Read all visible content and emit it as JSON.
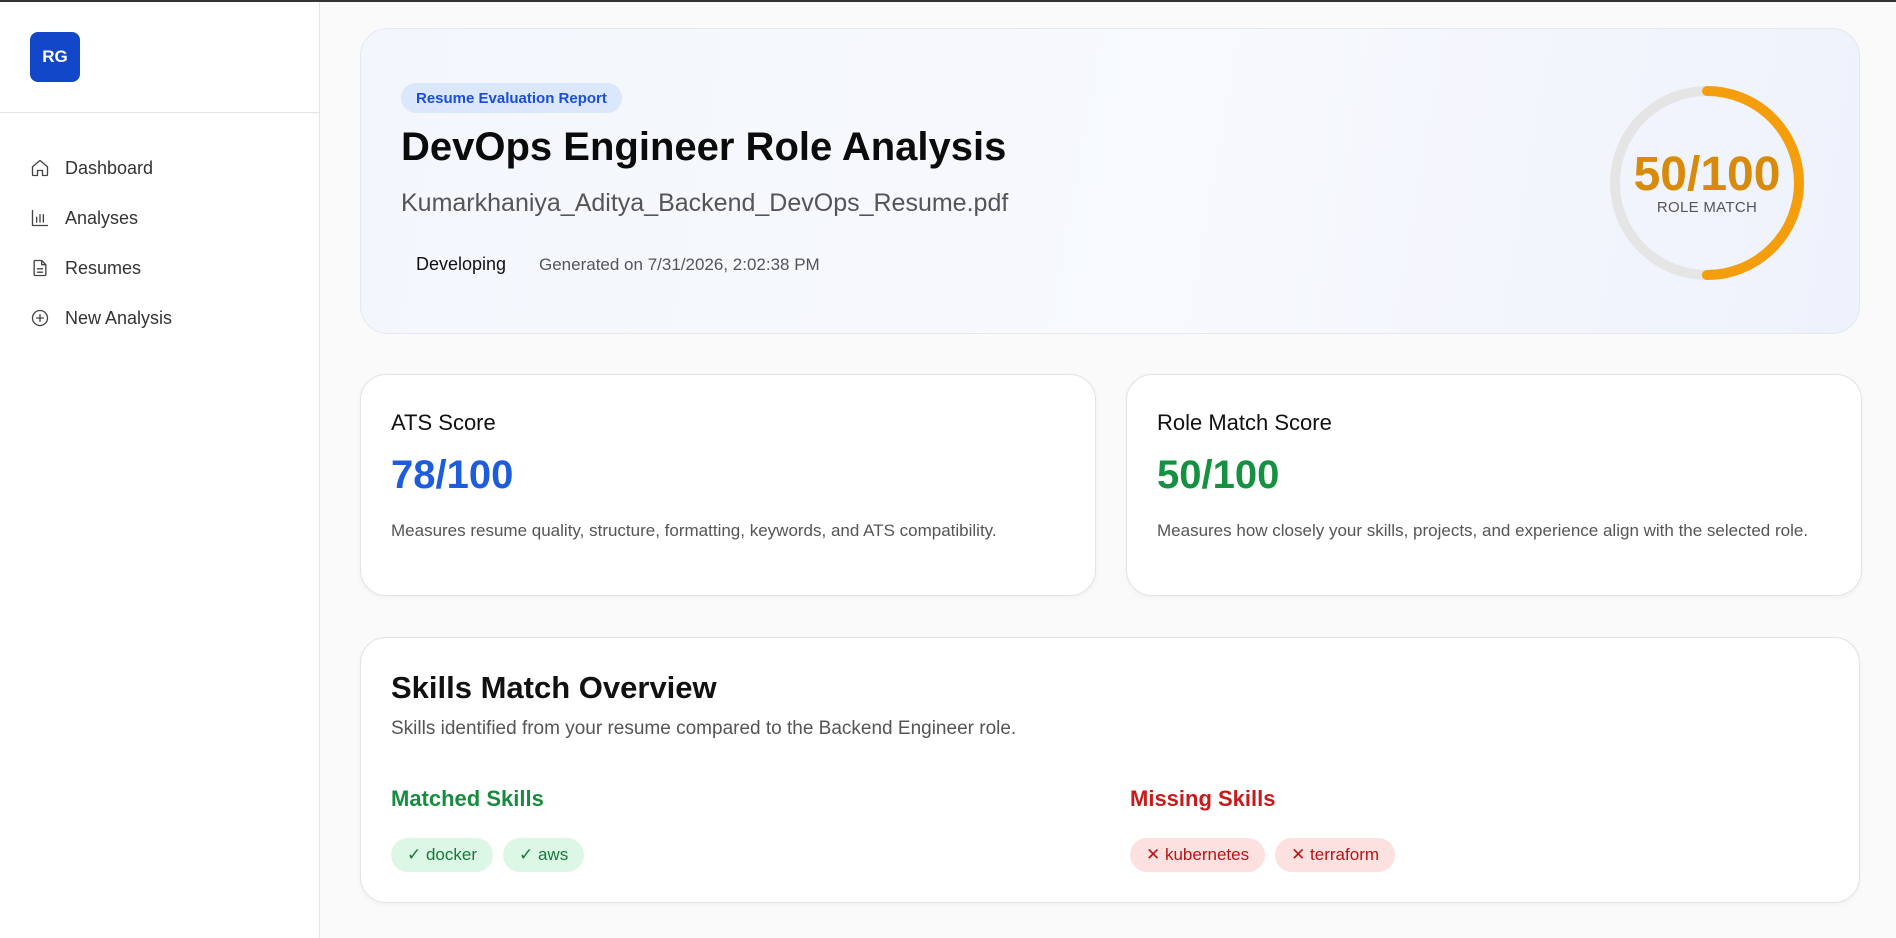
{
  "sidebar": {
    "logo": "RG",
    "items": [
      {
        "label": "Dashboard",
        "icon": "home-icon"
      },
      {
        "label": "Analyses",
        "icon": "bar-chart-icon"
      },
      {
        "label": "Resumes",
        "icon": "document-icon"
      },
      {
        "label": "New Analysis",
        "icon": "plus-circle-icon"
      }
    ]
  },
  "hero": {
    "badge": "Resume Evaluation Report",
    "title": "DevOps Engineer Role Analysis",
    "file": "Kumarkhaniya_Aditya_Backend_DevOps_Resume.pdf",
    "level": "Developing",
    "generated": "Generated on 7/31/2026, 2:02:38 PM",
    "gauge": {
      "score_text": "50/100",
      "label": "ROLE MATCH",
      "value": 50,
      "max": 100,
      "color": "#f59e0b",
      "track_color": "#e5e5e5"
    }
  },
  "cards": {
    "ats": {
      "title": "ATS Score",
      "score": "78/100",
      "description": "Measures resume quality, structure, formatting, keywords, and ATS compatibility.",
      "color": "#1d5cdb"
    },
    "role": {
      "title": "Role Match Score",
      "score": "50/100",
      "description": "Measures how closely your skills, projects, and experience align with the selected role.",
      "color": "#159141"
    }
  },
  "skills": {
    "title": "Skills Match Overview",
    "subtitle": "Skills identified from your resume compared to the Backend Engineer role.",
    "matched_heading": "Matched Skills",
    "missing_heading": "Missing Skills",
    "matched": [
      "✓ docker",
      "✓ aws"
    ],
    "missing": [
      "✕ kubernetes",
      "✕ terraform"
    ]
  }
}
